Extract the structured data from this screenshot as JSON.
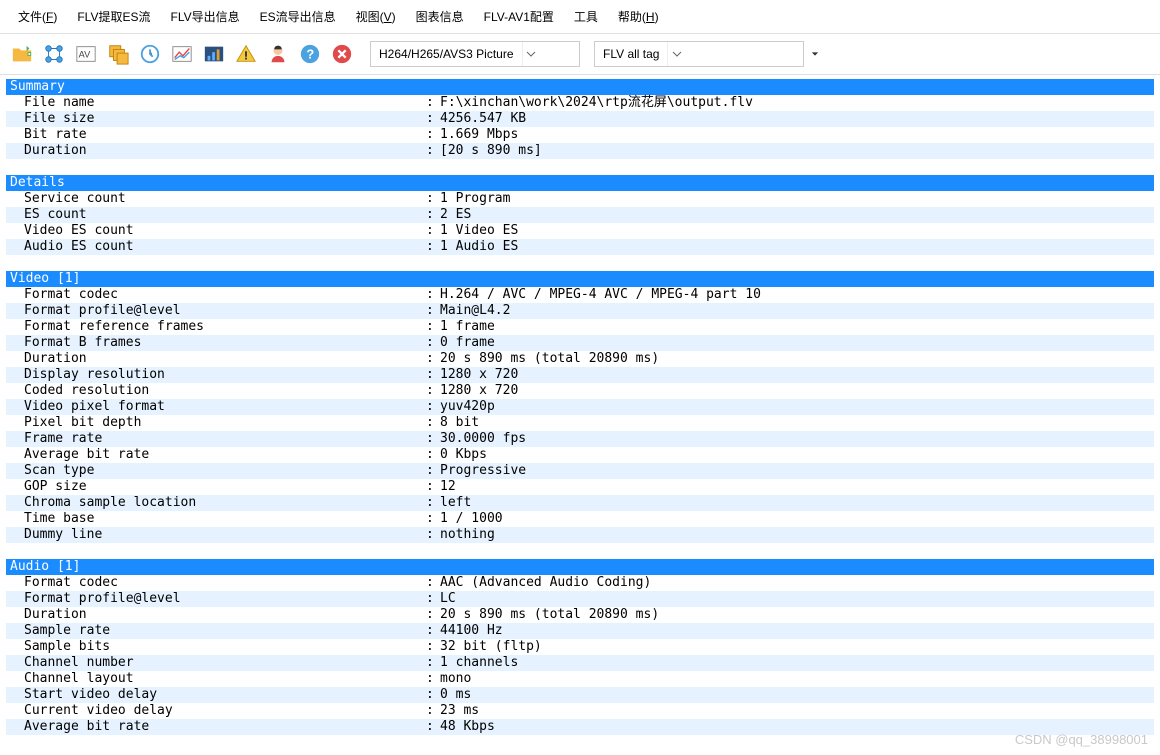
{
  "menu": [
    "文件(F)",
    "FLV提取ES流",
    "FLV导出信息",
    "ES流导出信息",
    "视图(V)",
    "图表信息",
    "FLV-AV1配置",
    "工具",
    "帮助(H)"
  ],
  "combo1": {
    "value": "H264/H265/AVS3 Picture"
  },
  "combo2": {
    "value": "FLV all tag"
  },
  "sections": [
    {
      "title": "Summary",
      "rows": [
        {
          "label": "File name",
          "value": "F:\\xinchan\\work\\2024\\rtp流花屏\\output.flv"
        },
        {
          "label": "File size",
          "value": "4256.547 KB"
        },
        {
          "label": "Bit rate",
          "value": "1.669 Mbps"
        },
        {
          "label": "Duration",
          "value": "[20 s 890 ms]"
        }
      ]
    },
    {
      "title": "Details",
      "rows": [
        {
          "label": "Service count",
          "value": "1 Program"
        },
        {
          "label": "ES count",
          "value": "2 ES"
        },
        {
          "label": "Video ES count",
          "value": "1 Video ES"
        },
        {
          "label": "Audio ES count",
          "value": "1 Audio ES"
        }
      ]
    },
    {
      "title": "Video [1]",
      "rows": [
        {
          "label": "Format codec",
          "value": "H.264 / AVC / MPEG-4 AVC / MPEG-4 part 10"
        },
        {
          "label": "Format profile@level",
          "value": "Main@L4.2"
        },
        {
          "label": "Format reference frames",
          "value": "1 frame"
        },
        {
          "label": "Format B frames",
          "value": "0 frame"
        },
        {
          "label": "Duration",
          "value": "20 s 890 ms (total 20890 ms)"
        },
        {
          "label": "Display resolution",
          "value": "1280 x 720"
        },
        {
          "label": "Coded resolution",
          "value": "1280 x 720"
        },
        {
          "label": "Video pixel format",
          "value": "yuv420p"
        },
        {
          "label": "Pixel bit depth",
          "value": "8 bit"
        },
        {
          "label": "Frame rate",
          "value": "30.0000 fps"
        },
        {
          "label": "Average bit rate",
          "value": "0 Kbps"
        },
        {
          "label": "Scan type",
          "value": "Progressive"
        },
        {
          "label": "GOP size",
          "value": "12"
        },
        {
          "label": "Chroma sample location",
          "value": "left"
        },
        {
          "label": "Time base",
          "value": "1 / 1000"
        },
        {
          "label": "Dummy line",
          "value": "nothing"
        }
      ]
    },
    {
      "title": "Audio [1]",
      "rows": [
        {
          "label": "Format codec",
          "value": "AAC (Advanced Audio Coding)"
        },
        {
          "label": "Format profile@level",
          "value": "LC"
        },
        {
          "label": "Duration",
          "value": "20 s 890 ms (total 20890 ms)"
        },
        {
          "label": "Sample rate",
          "value": "44100 Hz"
        },
        {
          "label": "Sample bits",
          "value": "32 bit (fltp)"
        },
        {
          "label": "Channel number",
          "value": "1 channels"
        },
        {
          "label": "Channel layout",
          "value": "mono"
        },
        {
          "label": "Start video delay",
          "value": "0 ms"
        },
        {
          "label": "Current video delay",
          "value": "23 ms"
        },
        {
          "label": "Average bit rate",
          "value": "48 Kbps"
        }
      ]
    }
  ],
  "watermark": "CSDN @qq_38998001"
}
